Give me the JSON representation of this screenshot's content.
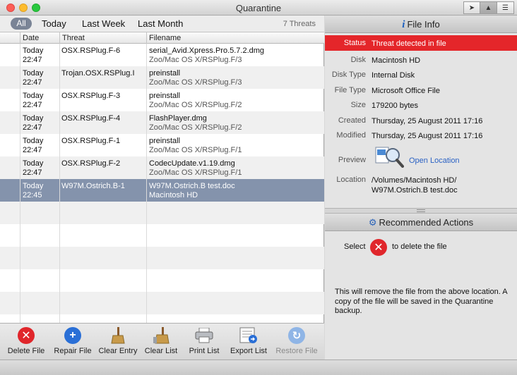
{
  "window": {
    "title": "Quarantine"
  },
  "filters": {
    "items": [
      "All",
      "Today",
      "Last Week",
      "Last Month"
    ],
    "selected": "All",
    "count": "7 Threats"
  },
  "columns": {
    "date": "Date",
    "threat": "Threat",
    "filename": "Filename"
  },
  "threats": [
    {
      "date": "Today",
      "time": "22:47",
      "threat": "OSX.RSPlug.F-6",
      "file": "serial_Avid.Xpress.Pro.5.7.2.dmg",
      "path": "Zoo/Mac OS X/RSPlug.F/3"
    },
    {
      "date": "Today",
      "time": "22:47",
      "threat": "Trojan.OSX.RSPlug.I",
      "file": "preinstall",
      "path": "Zoo/Mac OS X/RSPlug.F/3"
    },
    {
      "date": "Today",
      "time": "22:47",
      "threat": "OSX.RSPlug.F-3",
      "file": "preinstall",
      "path": "Zoo/Mac OS X/RSPlug.F/2"
    },
    {
      "date": "Today",
      "time": "22:47",
      "threat": "OSX.RSPlug.F-4",
      "file": "FlashPlayer.dmg",
      "path": "Zoo/Mac OS X/RSPlug.F/2"
    },
    {
      "date": "Today",
      "time": "22:47",
      "threat": "OSX.RSPlug.F-1",
      "file": "preinstall",
      "path": "Zoo/Mac OS X/RSPlug.F/1"
    },
    {
      "date": "Today",
      "time": "22:47",
      "threat": "OSX.RSPlug.F-2",
      "file": "CodecUpdate.v1.19.dmg",
      "path": "Zoo/Mac OS X/RSPlug.F/1"
    },
    {
      "date": "Today",
      "time": "22:45",
      "threat": "W97M.Ostrich.B-1",
      "file": "W97M.Ostrich.B test.doc",
      "path": "Macintosh HD"
    }
  ],
  "toolbar": {
    "delete": "Delete File",
    "repair": "Repair File",
    "clear_entry": "Clear Entry",
    "clear_list": "Clear List",
    "print": "Print List",
    "export": "Export List",
    "restore": "Restore File"
  },
  "file_info": {
    "header": "File Info",
    "status_label": "Status",
    "status_value": "Threat detected in file",
    "disk_label": "Disk",
    "disk_value": "Macintosh HD",
    "disktype_label": "Disk Type",
    "disktype_value": "Internal Disk",
    "filetype_label": "File Type",
    "filetype_value": "Microsoft Office File",
    "size_label": "Size",
    "size_value": "179200 bytes",
    "created_label": "Created",
    "created_value": "Thursday, 25 August 2011 17:16",
    "modified_label": "Modified",
    "modified_value": "Thursday, 25 August 2011 17:16",
    "preview_label": "Preview",
    "preview_link": "Open Location",
    "location_label": "Location",
    "location_line1": "/Volumes/Macintosh HD/",
    "location_line2": "W97M.Ostrich.B test.doc"
  },
  "actions": {
    "header": "Recommended Actions",
    "select_prefix": "Select",
    "select_suffix": "to delete the file",
    "note": "This will remove the file from the above location. A copy of the file will be saved in the Quarantine backup."
  },
  "colors": {
    "status_red": "#e4262a",
    "selection": "#8493ac",
    "link": "#2b62c4"
  }
}
